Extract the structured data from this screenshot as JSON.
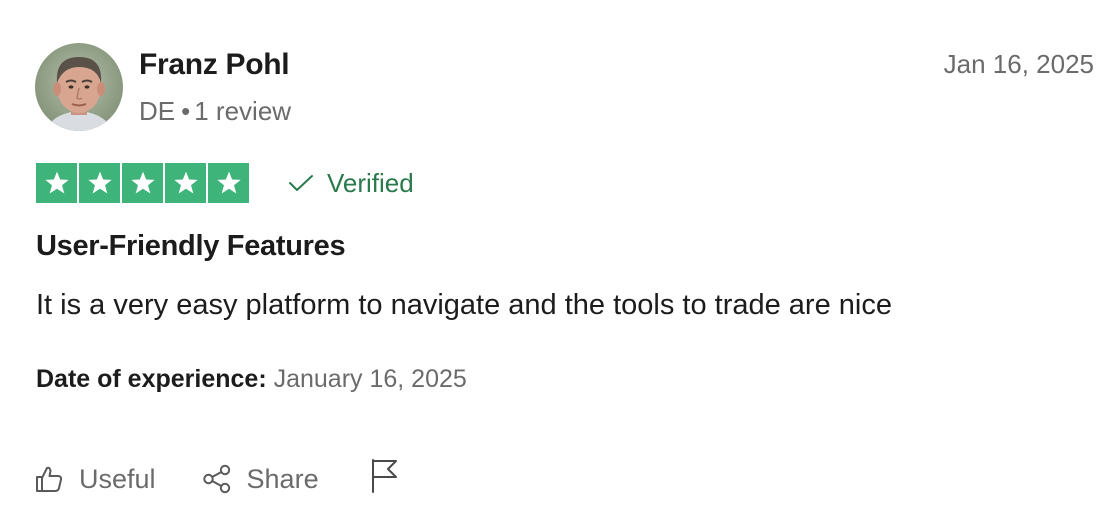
{
  "reviewer": {
    "name": "Franz Pohl",
    "country": "DE",
    "separator": "•",
    "review_count": "1 review",
    "avatar_icon": "reviewer-photo"
  },
  "review": {
    "date": "Jan 16, 2025",
    "rating": 5,
    "rating_max": 5,
    "star_color": "#3eb37a",
    "verified_label": "Verified",
    "verified_color": "#2a7a4c",
    "title": "User-Friendly Features",
    "body": "It is a very easy platform to navigate and the tools to trade are nice",
    "experience_label": "Date of experience:",
    "experience_date": "January 16, 2025"
  },
  "actions": {
    "useful_label": "Useful",
    "share_label": "Share",
    "useful_icon": "thumbs-up-icon",
    "share_icon": "share-icon",
    "report_icon": "flag-icon"
  }
}
